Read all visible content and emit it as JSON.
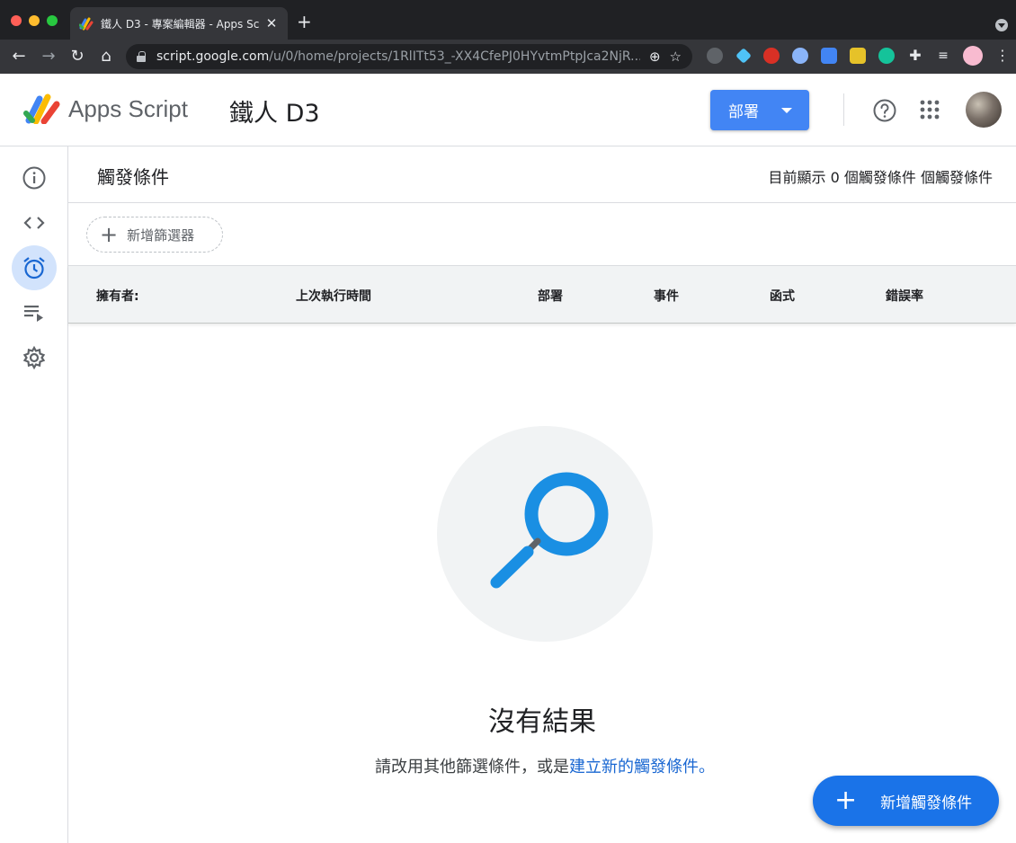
{
  "browser": {
    "tab_title": "鐵人 D3 - 專案編輯器 - Apps Sc",
    "url_host": "script.google.com",
    "url_path": "/u/0/home/projects/1RlITt53_-XX4CfePJ0HYvtmPtpJca2NjR..."
  },
  "header": {
    "product_name": "Apps Script",
    "project_name": "鐵人 D3",
    "deploy_label": "部署"
  },
  "rail": {
    "items": [
      "info-icon",
      "code-icon",
      "alarm-icon",
      "executions-icon",
      "settings-icon"
    ],
    "active": "alarm-icon"
  },
  "main": {
    "title": "觸發條件",
    "count_text": "目前顯示 0 個觸發條件 個觸發條件",
    "filter_label": "新增篩選器",
    "columns": [
      "擁有者:",
      "上次執行時間",
      "部署",
      "事件",
      "函式",
      "錯誤率"
    ],
    "empty_title": "沒有結果",
    "empty_desc_prefix": "請改用其他篩選條件，或是",
    "empty_desc_link": "建立新的觸發條件。",
    "fab_label": "新增觸發條件"
  },
  "colors": {
    "accent": "#1a73e8",
    "deploy": "#4285f4",
    "active_rail": "#d2e3fc",
    "search_blue": "#1a8fe3"
  }
}
